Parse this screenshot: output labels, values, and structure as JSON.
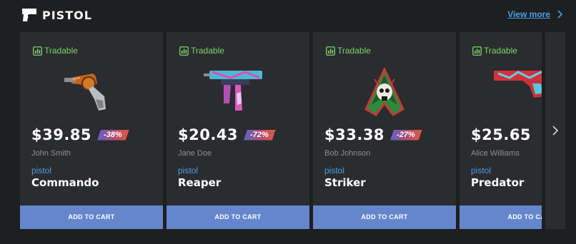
{
  "header": {
    "logo_icon": "pistol-logo-icon",
    "title": "PISTOL",
    "view_more": "View more",
    "view_more_icon": "chevron-right-icon"
  },
  "carousel": {
    "next_icon": "chevron-right-icon",
    "cards": [
      {
        "tradable": "Tradable",
        "price": "$39.85",
        "discount": "-38%",
        "seller": "John Smith",
        "category": "pistol",
        "name": "Commando",
        "button": "ADD TO CART",
        "image": "revolver-orange"
      },
      {
        "tradable": "Tradable",
        "price": "$20.43",
        "discount": "-72%",
        "seller": "Jane Doe",
        "category": "pistol",
        "name": "Reaper",
        "button": "ADD TO CART",
        "image": "smg-pink-blue"
      },
      {
        "tradable": "Tradable",
        "price": "$33.38",
        "discount": "-27%",
        "seller": "Bob Johnson",
        "category": "pistol",
        "name": "Striker",
        "button": "ADD TO CART",
        "image": "skull-sticker"
      },
      {
        "tradable": "Tradable",
        "price": "$25.65",
        "discount": "",
        "seller": "Alice Williams",
        "category": "pistol",
        "name": "Predator",
        "button": "ADD TO CART",
        "image": "pistol-red-cyan"
      }
    ]
  },
  "colors": {
    "background": "#1d1f21",
    "card": "#2a2c2f",
    "accent_blue": "#4d9ee8",
    "tradable_green": "#7fd36b",
    "button": "#6586cd"
  }
}
